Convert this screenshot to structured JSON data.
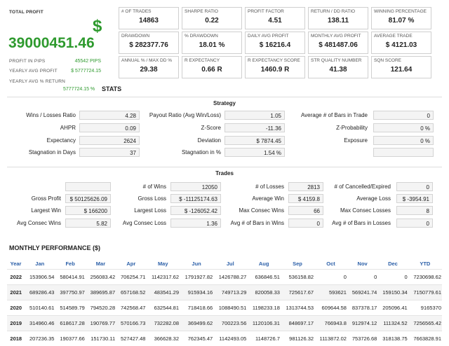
{
  "summary": {
    "total_profit_label": "TOTAL PROFIT",
    "dollar_sign": "$",
    "total_profit_value": "39000451.46",
    "profit_pips_label": "PROFIT IN PIPS",
    "profit_pips_value": "45542 PIPS",
    "yearly_avg_profit_label": "YEARLY AVG PROFIT",
    "yearly_avg_profit_value": "$ 5777724.15",
    "yearly_avg_return_label": "YEARLY AVG % RETURN",
    "yearly_avg_return_value": "5777724.15 %"
  },
  "metrics": [
    {
      "label": "# OF TRADES",
      "value": "14863"
    },
    {
      "label": "SHARPE RATIO",
      "value": "0.22"
    },
    {
      "label": "PROFIT FACTOR",
      "value": "4.51"
    },
    {
      "label": "RETURN / DD RATIO",
      "value": "138.11"
    },
    {
      "label": "WINNING PERCENTAGE",
      "value": "81.07 %"
    },
    {
      "label": "DRAWDOWN",
      "value": "$ 282377.76"
    },
    {
      "label": "% DRAWDOWN",
      "value": "18.01 %"
    },
    {
      "label": "DAILY AVG PROFIT",
      "value": "$ 16216.4"
    },
    {
      "label": "MONTHLY AVG PROFIT",
      "value": "$ 481487.06"
    },
    {
      "label": "AVERAGE TRADE",
      "value": "$ 4121.03"
    },
    {
      "label": "ANNUAL % / MAX DD %",
      "value": "29.38"
    },
    {
      "label": "R EXPECTANCY",
      "value": "0.66 R"
    },
    {
      "label": "R EXPECTANCY SCORE",
      "value": "1460.9 R"
    },
    {
      "label": "STR QUALITY NUMBER",
      "value": "41.38"
    },
    {
      "label": "SQN SCORE",
      "value": "121.64"
    }
  ],
  "stats_title": "STATS",
  "strategy": {
    "title": "Strategy",
    "rows": [
      [
        {
          "label": "Wins / Losses Ratio",
          "value": "4.28"
        },
        {
          "label": "Payout Ratio (Avg Win/Loss)",
          "value": "1.05"
        },
        {
          "label": "Average # of Bars in Trade",
          "value": "0"
        }
      ],
      [
        {
          "label": "AHPR",
          "value": "0.09"
        },
        {
          "label": "Z-Score",
          "value": "-11.36"
        },
        {
          "label": "Z-Probability",
          "value": "0 %"
        }
      ],
      [
        {
          "label": "Expectancy",
          "value": "2624"
        },
        {
          "label": "Deviation",
          "value": "$ 7874.45"
        },
        {
          "label": "Exposure",
          "value": "0 %"
        }
      ],
      [
        {
          "label": "Stagnation in Days",
          "value": "37"
        },
        {
          "label": "Stagnation in %",
          "value": "1.54 %"
        },
        {
          "label": "",
          "value": ""
        }
      ]
    ]
  },
  "trades": {
    "title": "Trades",
    "rows": [
      [
        {
          "label": "",
          "value": ""
        },
        {
          "label": "# of Wins",
          "value": "12050"
        },
        {
          "label": "# of Losses",
          "value": "2813"
        },
        {
          "label": "# of Cancelled/Expired",
          "value": "0"
        }
      ],
      [
        {
          "label": "Gross Profit",
          "value": "$ 50125626.09"
        },
        {
          "label": "Gross Loss",
          "value": "$ -11125174.63"
        },
        {
          "label": "Average Win",
          "value": "$ 4159.8"
        },
        {
          "label": "Average Loss",
          "value": "$ -3954.91"
        }
      ],
      [
        {
          "label": "Largest Win",
          "value": "$ 166200"
        },
        {
          "label": "Largest Loss",
          "value": "$ -126052.42"
        },
        {
          "label": "Max Consec Wins",
          "value": "66"
        },
        {
          "label": "Max Consec Losses",
          "value": "8"
        }
      ],
      [
        {
          "label": "Avg Consec Wins",
          "value": "5.82"
        },
        {
          "label": "Avg Consec Loss",
          "value": "1.36"
        },
        {
          "label": "Avg # of Bars in Wins",
          "value": "0"
        },
        {
          "label": "Avg # of Bars in Losses",
          "value": "0"
        }
      ]
    ]
  },
  "monthly": {
    "title": "MONTHLY PERFORMANCE ($)",
    "headers": [
      "Year",
      "Jan",
      "Feb",
      "Mar",
      "Apr",
      "May",
      "Jun",
      "Jul",
      "Aug",
      "Sep",
      "Oct",
      "Nov",
      "Dec",
      "YTD"
    ],
    "rows": [
      [
        "2022",
        "153906.54",
        "580414.91",
        "256083.42",
        "706254.71",
        "1142317.62",
        "1791927.82",
        "1426788.27",
        "636846.51",
        "536158.82",
        "0",
        "0",
        "0",
        "7230698.62"
      ],
      [
        "2021",
        "689286.43",
        "397750.97",
        "389695.87",
        "657168.52",
        "483541.29",
        "915934.16",
        "749713.29",
        "820058.33",
        "725617.67",
        "593621",
        "569241.74",
        "159150.34",
        "7150779.61"
      ],
      [
        "2020",
        "510140.61",
        "514589.79",
        "794520.28",
        "742568.47",
        "632544.81",
        "718418.66",
        "1088490.51",
        "1198233.18",
        "1313744.53",
        "609644.58",
        "837378.17",
        "205096.41",
        "9165370"
      ],
      [
        "2019",
        "314960.46",
        "618617.28",
        "190769.77",
        "570166.73",
        "732282.08",
        "369499.62",
        "700223.56",
        "1120106.31",
        "848697.17",
        "766943.8",
        "912974.12",
        "111324.52",
        "7256565.42"
      ],
      [
        "2018",
        "207236.35",
        "190377.66",
        "151730.11",
        "527427.48",
        "366628.32",
        "762345.47",
        "1142493.05",
        "1148726.7",
        "981126.32",
        "1113872.02",
        "753726.68",
        "318138.75",
        "7663828.91"
      ]
    ]
  }
}
